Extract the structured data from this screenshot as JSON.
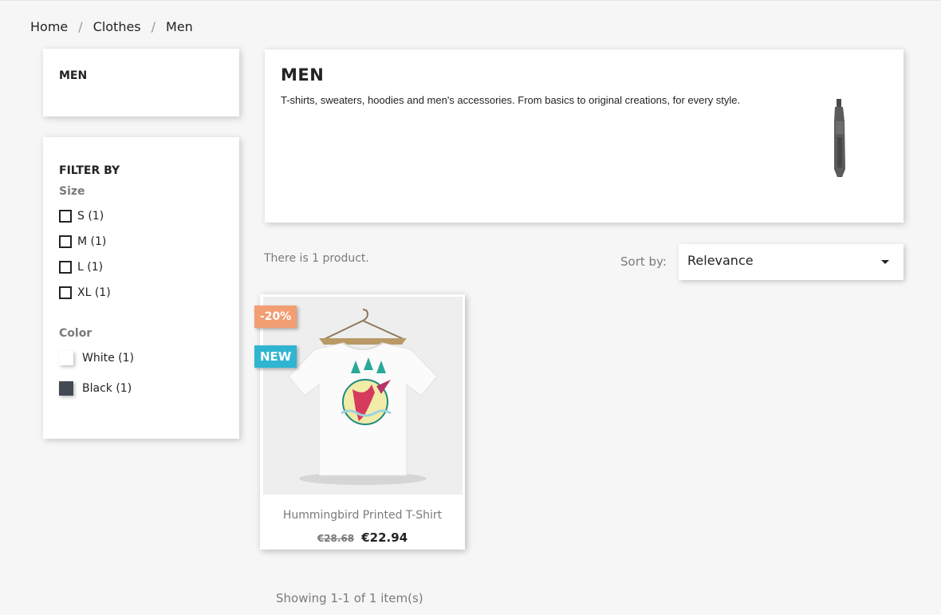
{
  "breadcrumb": {
    "items": [
      "Home",
      "Clothes",
      "Men"
    ],
    "separator": "/"
  },
  "sidebar": {
    "category_title": "MEN",
    "filter_title": "FILTER BY",
    "size_label": "Size",
    "sizes": [
      "S (1)",
      "M (1)",
      "L (1)",
      "XL (1)"
    ],
    "color_label": "Color",
    "colors": [
      {
        "label": "White (1)",
        "hex": "#ffffff"
      },
      {
        "label": "Black (1)",
        "hex": "#434a54"
      }
    ]
  },
  "header": {
    "title": "MEN",
    "description": "T-shirts, sweaters, hoodies and men's accessories. From basics to original creations, for every style."
  },
  "listing": {
    "count_text": "There is 1 product.",
    "sort_label": "Sort by:",
    "sort_value": "Relevance",
    "showing_text": "Showing 1-1 of 1 item(s)"
  },
  "product": {
    "name": "Hummingbird Printed T-Shirt",
    "old_price": "€28.68",
    "price": "€22.94",
    "badge_discount": "-20%",
    "badge_new": "NEW"
  },
  "colors": {
    "discount_badge": "#f39d72",
    "new_badge": "#2fb5d2",
    "text": "#232323",
    "muted": "#7a7a7a"
  }
}
